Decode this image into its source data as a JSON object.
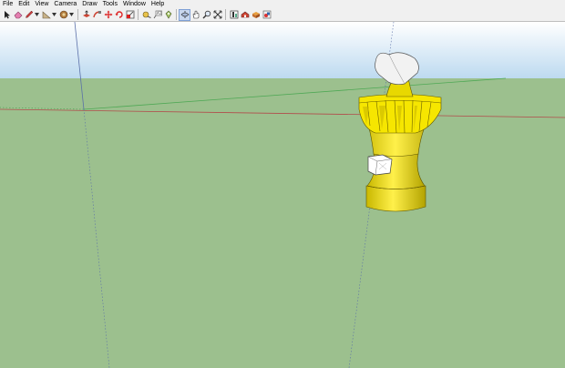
{
  "menu": {
    "items": [
      {
        "label": "File"
      },
      {
        "label": "Edit"
      },
      {
        "label": "View"
      },
      {
        "label": "Camera"
      },
      {
        "label": "Draw"
      },
      {
        "label": "Tools"
      },
      {
        "label": "Window"
      },
      {
        "label": "Help"
      }
    ]
  },
  "toolbar": {
    "tools": [
      {
        "icon": "select-arrow-icon"
      },
      {
        "icon": "eraser-icon"
      },
      {
        "icon": "pencil-icon",
        "dropdown": true
      },
      {
        "icon": "shapes-icon",
        "dropdown": true
      },
      {
        "icon": "paint-bucket-icon",
        "dropdown": true
      },
      {
        "icon": "push-pull-icon"
      },
      {
        "icon": "follow-me-icon"
      },
      {
        "icon": "move-icon"
      },
      {
        "icon": "rotate-icon"
      },
      {
        "icon": "scale-icon"
      },
      {
        "icon": "tape-measure-icon"
      },
      {
        "icon": "text-label-icon"
      },
      {
        "icon": "paint-icon"
      },
      {
        "icon": "orbit-icon",
        "active": true
      },
      {
        "icon": "pan-icon"
      },
      {
        "icon": "zoom-icon"
      },
      {
        "icon": "zoom-extents-icon"
      },
      {
        "icon": "components-icon"
      },
      {
        "icon": "warehouse-icon"
      },
      {
        "icon": "extension-icon"
      },
      {
        "icon": "share-icon"
      }
    ]
  },
  "scene": {
    "sky_color": "#bddaf0",
    "ground_color": "#9cc08e",
    "model_color": "#f6e600",
    "red_axis_color": "#b24b4b",
    "green_axis_color": "#4fa855",
    "blue_axis_color": "#5a6fa8"
  }
}
